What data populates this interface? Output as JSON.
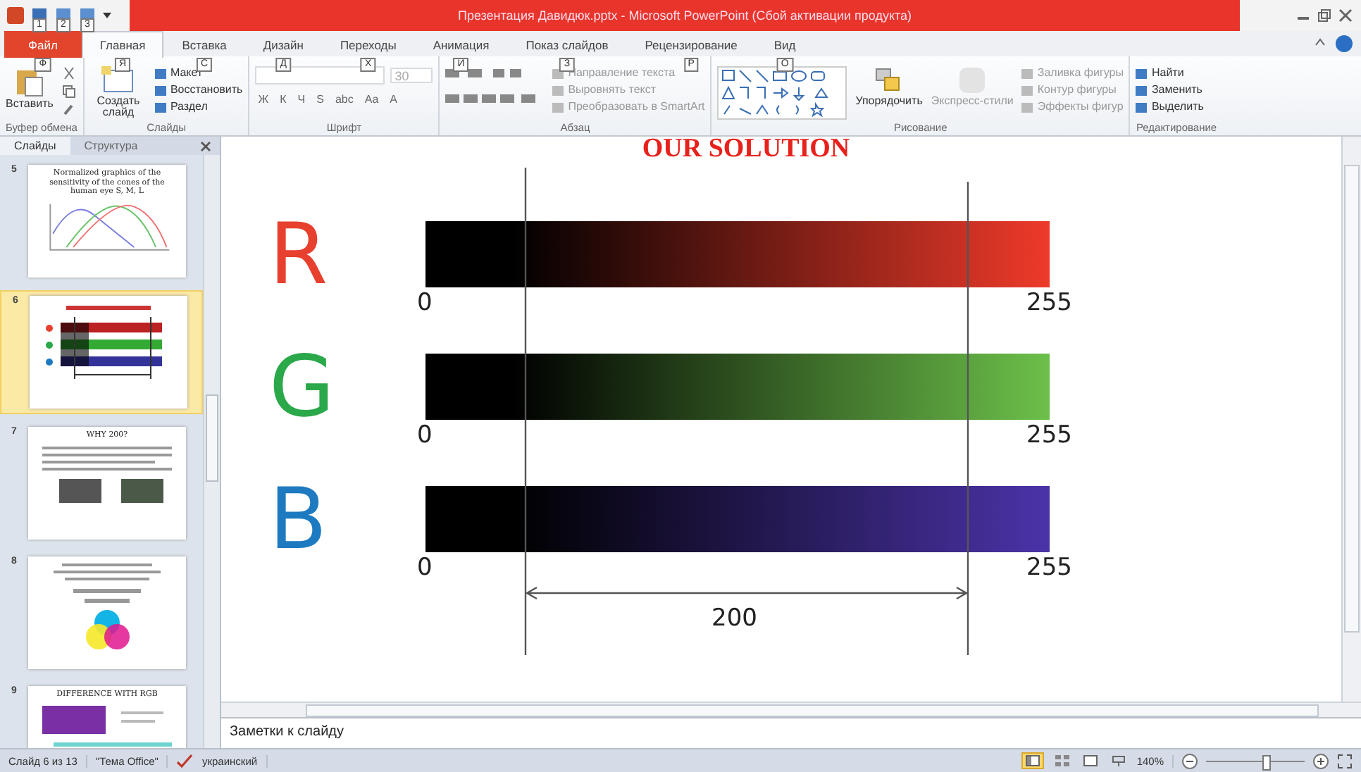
{
  "window": {
    "title": "Презентация Давидюк.pptx  -  Microsoft PowerPoint (Сбой активации продукта)"
  },
  "quick_access": [
    {
      "keytip": "1"
    },
    {
      "keytip": "2"
    },
    {
      "keytip": "3"
    }
  ],
  "tabs": [
    {
      "label": "Файл",
      "keytip": "Ф",
      "kind": "file",
      "selected": false
    },
    {
      "label": "Главная",
      "keytip": "Я",
      "kind": "normal",
      "selected": true
    },
    {
      "label": "Вставка",
      "keytip": "С",
      "kind": "normal",
      "selected": false
    },
    {
      "label": "Дизайн",
      "keytip": "Д",
      "kind": "normal",
      "selected": false
    },
    {
      "label": "Переходы",
      "keytip": "Х",
      "kind": "normal",
      "selected": false
    },
    {
      "label": "Анимация",
      "keytip": "И",
      "kind": "normal",
      "selected": false
    },
    {
      "label": "Показ слайдов",
      "keytip": "З",
      "kind": "normal",
      "selected": false
    },
    {
      "label": "Рецензирование",
      "keytip": "Р",
      "kind": "normal",
      "selected": false
    },
    {
      "label": "Вид",
      "keytip": "О",
      "kind": "normal",
      "selected": false
    }
  ],
  "ribbon": {
    "clipboard": {
      "label": "Буфер обмена",
      "paste": "Вставить"
    },
    "slides": {
      "label": "Слайды",
      "new_slide": "Создать слайд",
      "commands": [
        "Макет",
        "Восстановить",
        "Раздел"
      ]
    },
    "font": {
      "label": "Шрифт",
      "size": "30",
      "buttons": [
        "Ж",
        "К",
        "Ч",
        "S",
        "abc",
        "Aa",
        "A"
      ]
    },
    "paragraph": {
      "label": "Абзац",
      "commands": [
        "Направление текста",
        "Выровнять текст",
        "Преобразовать в SmartArt"
      ]
    },
    "drawing": {
      "label": "Рисование",
      "arrange": "Упорядочить",
      "quick_styles": "Экспресс-стили",
      "commands": [
        "Заливка фигуры",
        "Контур фигуры",
        "Эффекты фигур"
      ]
    },
    "editing": {
      "label": "Редактирование",
      "commands": [
        "Найти",
        "Заменить",
        "Выделить"
      ]
    }
  },
  "panel_tabs": [
    {
      "label": "Слайды",
      "selected": true
    },
    {
      "label": "Структура",
      "selected": false
    }
  ],
  "slides": [
    {
      "number": "5",
      "kind": "chart",
      "title": "Normalized graphics of the sensitivity of the cones of the human eye S, M, L",
      "selected": false
    },
    {
      "number": "6",
      "kind": "rgb",
      "selected": true
    },
    {
      "number": "7",
      "kind": "text",
      "title": "WHY 200?",
      "selected": false
    },
    {
      "number": "8",
      "kind": "cmy",
      "selected": false
    },
    {
      "number": "9",
      "kind": "compare",
      "title": "DIFFERENCE WITH RGB",
      "selected": false
    }
  ],
  "slide": {
    "title": "OUR SOLUTION",
    "channels": [
      {
        "letter": "R",
        "color": "#e8402f",
        "bar": {
          "color": "#ee3a2a"
        },
        "min": "0",
        "max": "255"
      },
      {
        "letter": "G",
        "color": "#2aa84a",
        "bar": {
          "color": "#6cc04a"
        },
        "min": "0",
        "max": "255"
      },
      {
        "letter": "B",
        "color": "#1e7ac0",
        "bar": {
          "color": "#4b33a8"
        },
        "min": "0",
        "max": "255"
      }
    ],
    "range_label": "200"
  },
  "notes": {
    "placeholder": "Заметки к слайду"
  },
  "status_bar": {
    "slide": "Слайд 6 из 13",
    "theme": "\"Тема Office\"",
    "language": "украинский",
    "zoom": "140%",
    "zoom_slider": {
      "level": 0.6
    },
    "views": [
      {
        "kind": "normal",
        "selected": true
      },
      {
        "kind": "sorter",
        "selected": false
      },
      {
        "kind": "reading",
        "selected": false
      },
      {
        "kind": "show",
        "selected": false
      }
    ]
  }
}
